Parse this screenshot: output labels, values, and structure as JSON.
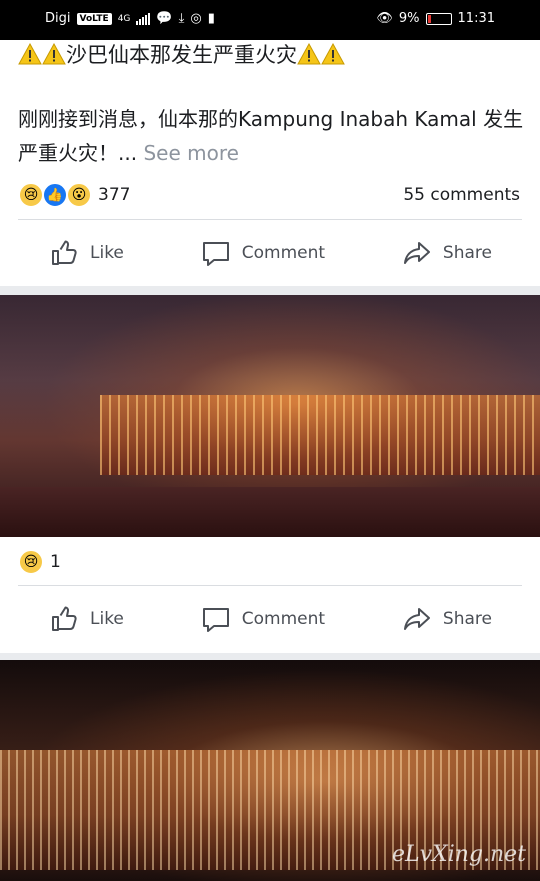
{
  "status_bar": {
    "carrier": "Digi",
    "volte": "VoLTE",
    "network": "4G",
    "battery": "9%",
    "time": "11:31"
  },
  "post": {
    "title": "沙巴仙本那发生严重火灾",
    "body": "刚刚接到消息，仙本那的Kampung Inabah Kamal 发生严重火灾！...",
    "see_more": "See more",
    "reaction_count": "377",
    "comments": "55 comments",
    "actions": {
      "like": "Like",
      "comment": "Comment",
      "share": "Share"
    }
  },
  "photo_post": {
    "reaction_count": "1",
    "actions": {
      "like": "Like",
      "comment": "Comment",
      "share": "Share"
    }
  },
  "watermark": "eLvXing.net",
  "colors": {
    "accent": "#1877f2",
    "text": "#1c1e21",
    "muted": "#8d949e"
  }
}
